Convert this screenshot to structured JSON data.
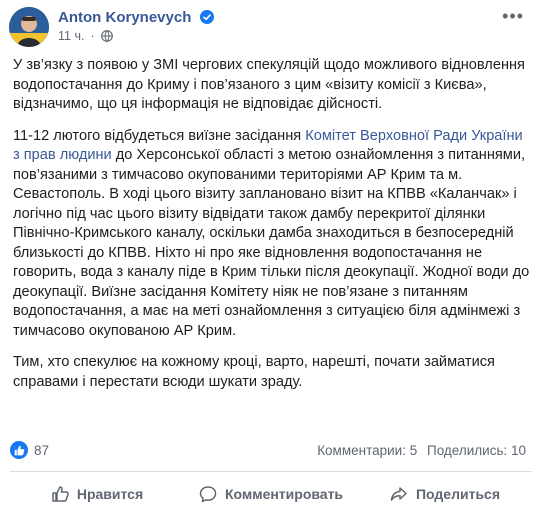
{
  "post": {
    "author": "Anton Korynevych",
    "time": "11 ч.",
    "separator": "·",
    "paragraphs": [
      {
        "plain": "У зв’язку з появою у ЗМІ чергових спекуляцій щодо можливого відновлення водопостачання до Криму і пов’язаного з цим «візиту комісії з Києва», відзначимо, що ця інформація не відповідає дійсності."
      },
      {
        "before": "11-12 лютого відбудеться виїзне засідання ",
        "link": "Комітет Верховної Ради України з прав людини",
        "after": " до Херсонської області з метою ознайомлення з питаннями, пов’язаними з тимчасово окупованими територіями АР Крим та м. Севастополь. В ході цього візиту заплановано візит на КПВВ «Каланчак» і логічно під час цього візиту відвідати також дамбу перекритої ділянки Північно-Кримського каналу, оскільки дамба знаходиться в безпосередній близькості до КПВВ. Ніхто ні про яке відновлення водопостачання не говорить, вода з каналу піде в Крим тільки після деокупації. Жодної води до деокупації. Виїзне засідання Комітету ніяк не пов’язане з питанням водопостачання, а має на меті ознайомлення з ситуацією біля адмінмежі з тимчасово окупованою АР Крим."
      },
      {
        "plain": "Тим, хто спекулює на кожному кроці, варто, нарешті, почати займатися справами і перестати всюди шукати зраду."
      }
    ]
  },
  "reactions": {
    "count": "87",
    "comments": "Комментарии: 5",
    "shares": "Поделились: 10"
  },
  "actions": {
    "like": "Нравится",
    "comment": "Комментировать",
    "share": "Поделиться"
  },
  "colors": {
    "link": "#385898",
    "like_blue": "#1877f2",
    "secondary_text": "#606770"
  }
}
